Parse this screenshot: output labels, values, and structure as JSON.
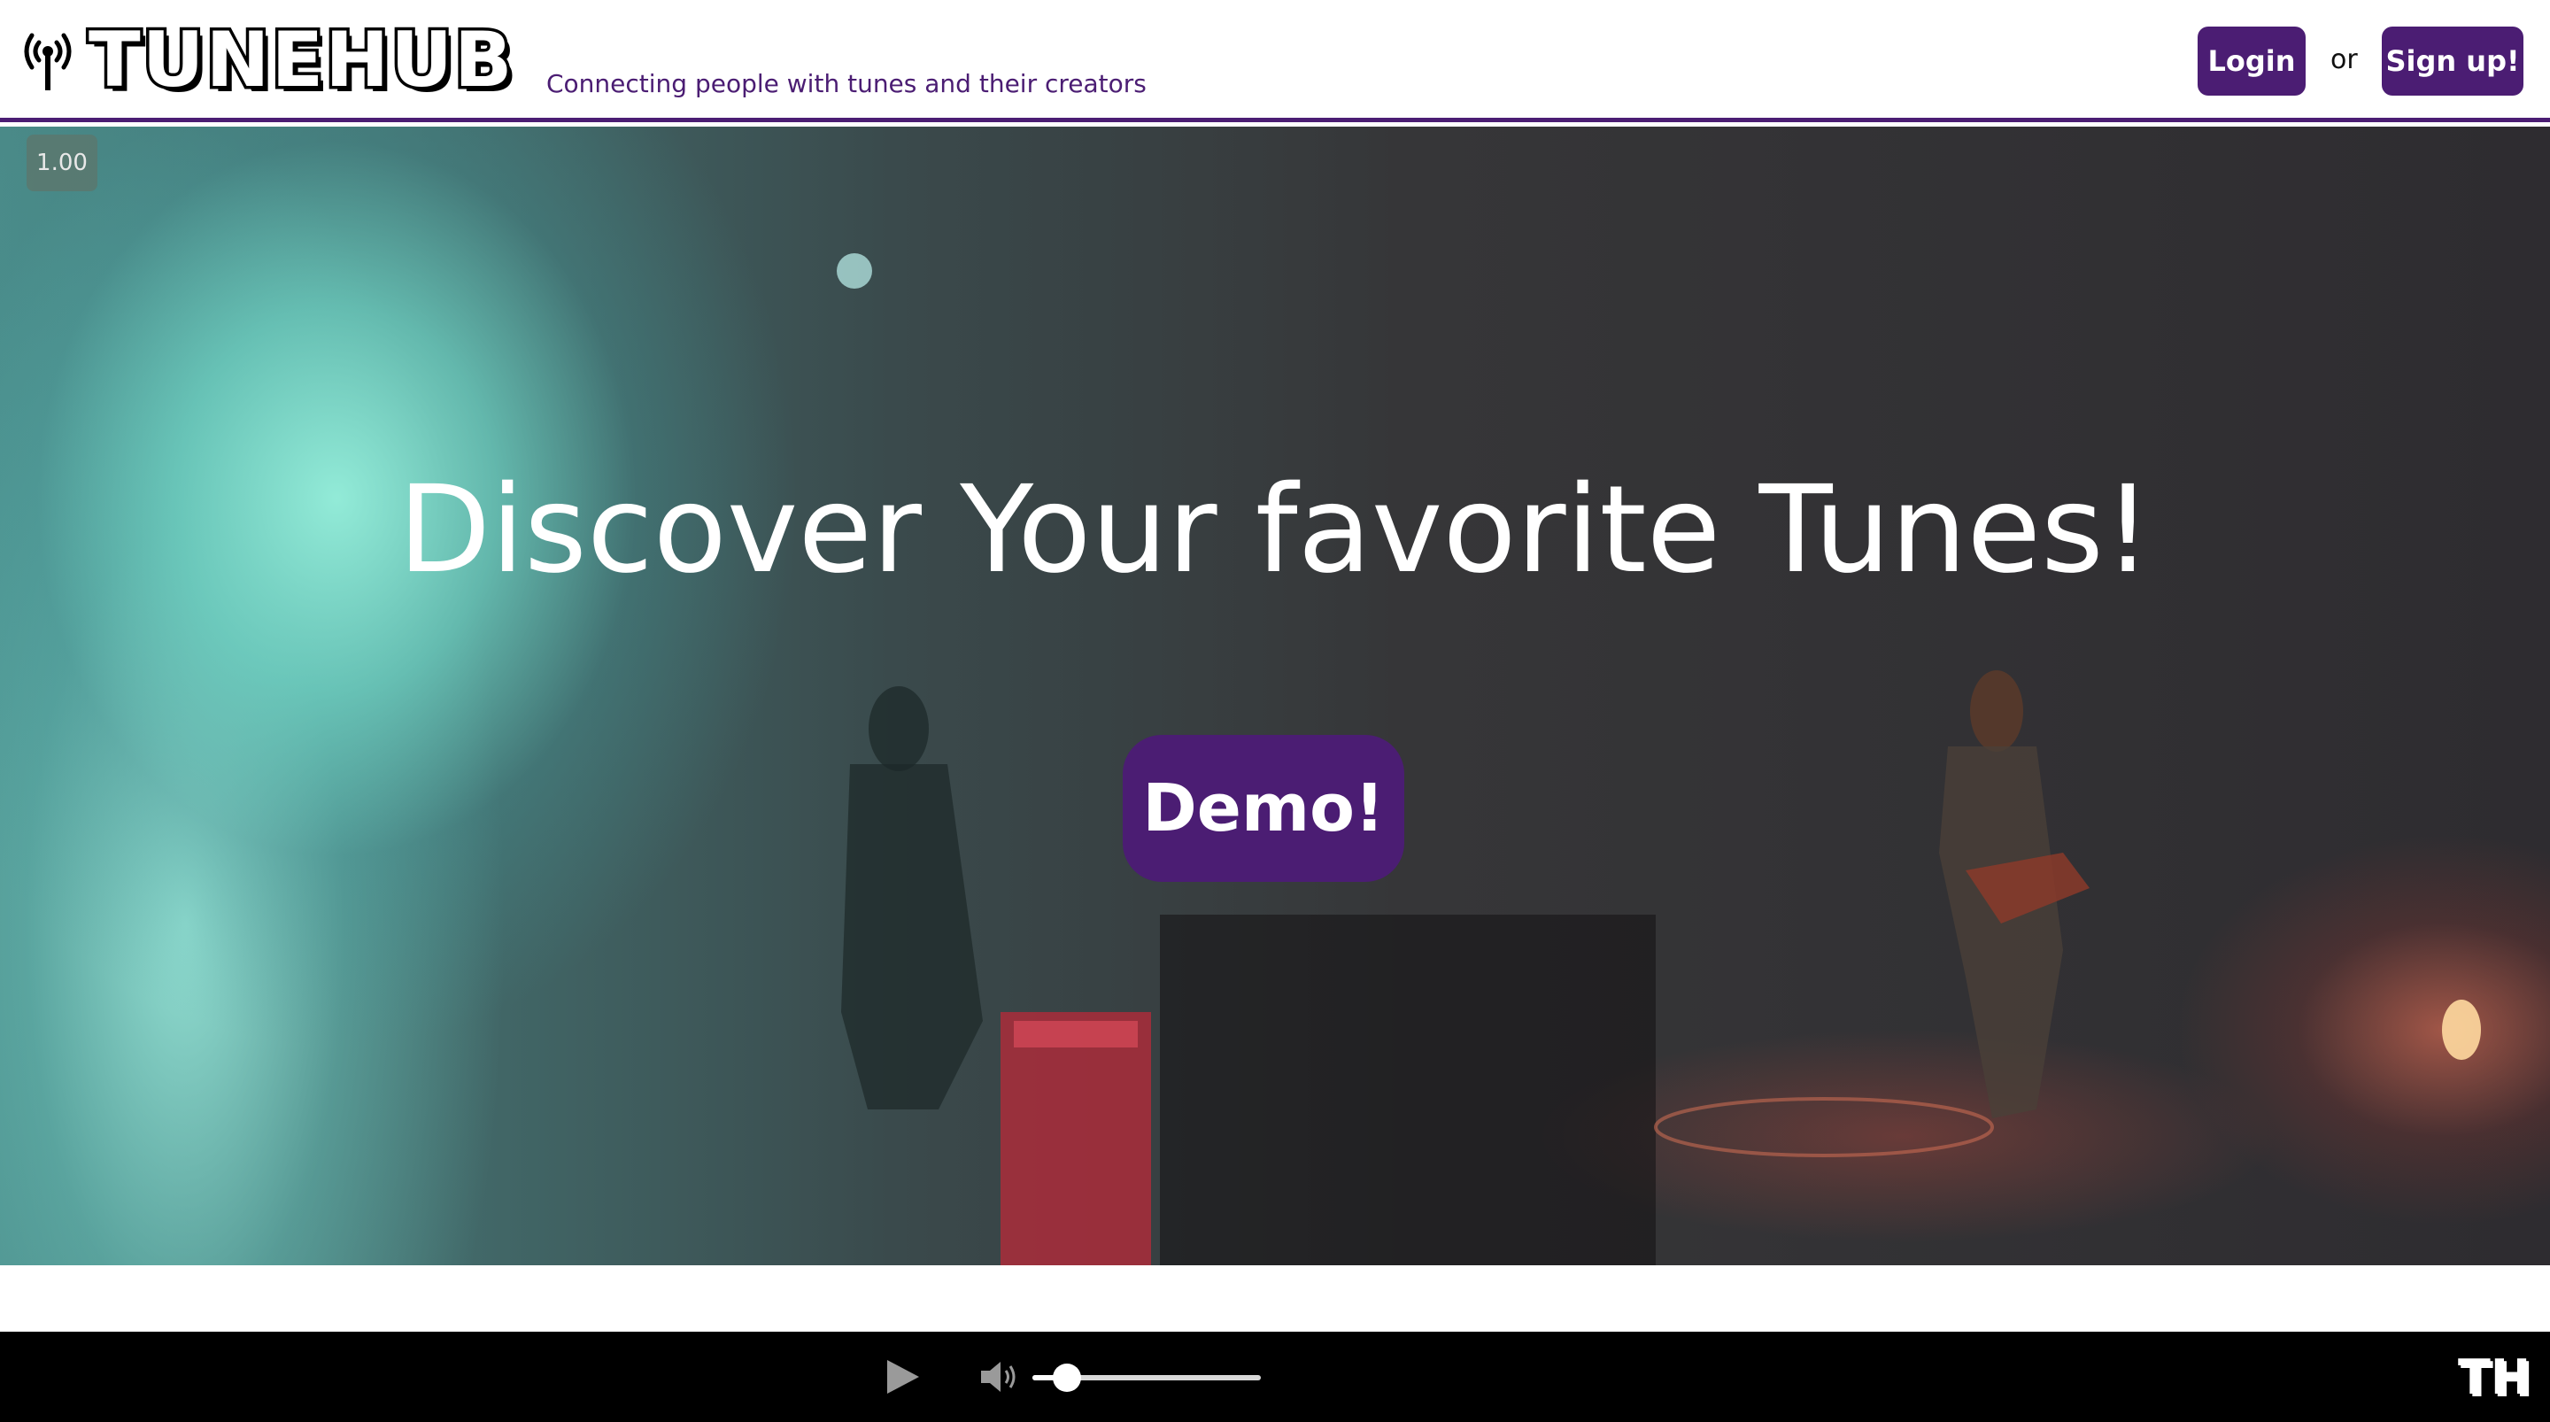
{
  "header": {
    "logo_text": "TUNEHUB",
    "tagline": "Connecting people with tunes and their creators",
    "login_label": "Login",
    "or_text": "or",
    "signup_label": "Sign up!"
  },
  "hero": {
    "playback_speed": "1.00",
    "title": "Discover Your favorite Tunes!",
    "demo_label": "Demo!"
  },
  "player": {
    "volume_level": 0.15,
    "logo_text": "TH"
  },
  "colors": {
    "brand_purple": "#4b1d73",
    "player_background": "#000000"
  },
  "icons": {
    "logo": "radio-antenna-icon",
    "play": "play-icon",
    "volume": "volume-icon"
  }
}
